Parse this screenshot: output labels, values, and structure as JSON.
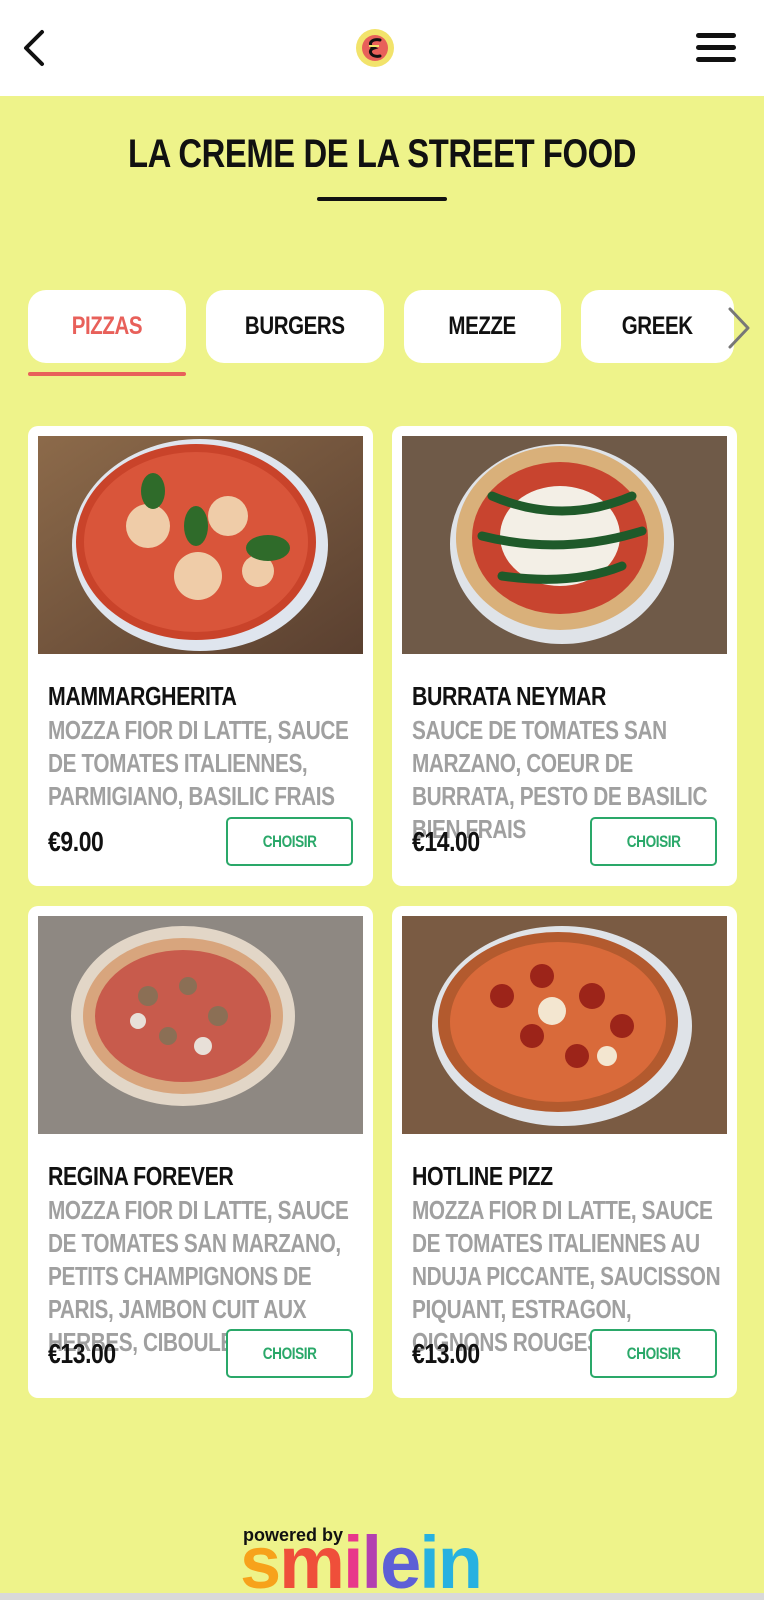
{
  "header": {
    "back_icon": "chevron-left-icon",
    "logo_icon": "brand-logo",
    "menu_icon": "hamburger-menu-icon"
  },
  "page": {
    "title": "LA CREME DE LA STREET FOOD"
  },
  "tabs": [
    {
      "label": "PIZZAS",
      "active": true
    },
    {
      "label": "BURGERS",
      "active": false
    },
    {
      "label": "MEZZE",
      "active": false
    },
    {
      "label": "GREEK",
      "active": false
    }
  ],
  "tabs_more_icon": "chevron-right-icon",
  "products": [
    {
      "name": "MAMMARGHERITA",
      "description": "MOZZA FIOR DI LATTE, SAUCE DE TOMATES ITALIENNES, PARMIGIANO, BASILIC FRAIS",
      "price": "€9.00",
      "button": "CHOISIR"
    },
    {
      "name": "BURRATA NEYMAR",
      "description": "SAUCE DE TOMATES SAN MARZANO, COEUR DE BURRATA, PESTO DE BASILIC BIEN FRAIS",
      "price": "€14.00",
      "button": "CHOISIR"
    },
    {
      "name": "REGINA FOREVER",
      "description": "MOZZA FIOR DI LATTE, SAUCE DE TOMATES SAN MARZANO, PETITS CHAMPIGNONS DE PARIS, JAMBON CUIT AUX HERBES, CIBOULETTE",
      "price": "€13.00",
      "button": "CHOISIR"
    },
    {
      "name": "HOTLINE PIZZ",
      "description": "MOZZA FIOR DI LATTE, SAUCE DE TOMATES ITALIENNES AU NDUJA PICCANTE, SAUCISSON PIQUANT, ESTRAGON, OIGNONS ROUGES...",
      "price": "€13.00",
      "button": "CHOISIR"
    }
  ],
  "footer": {
    "powered_by": "powered by",
    "brand_letters": [
      "s",
      "m",
      "i",
      "l",
      "e",
      "in"
    ]
  },
  "colors": {
    "background": "#eef38a",
    "active_tab": "#e8605a",
    "button_accent": "#2aa869"
  }
}
